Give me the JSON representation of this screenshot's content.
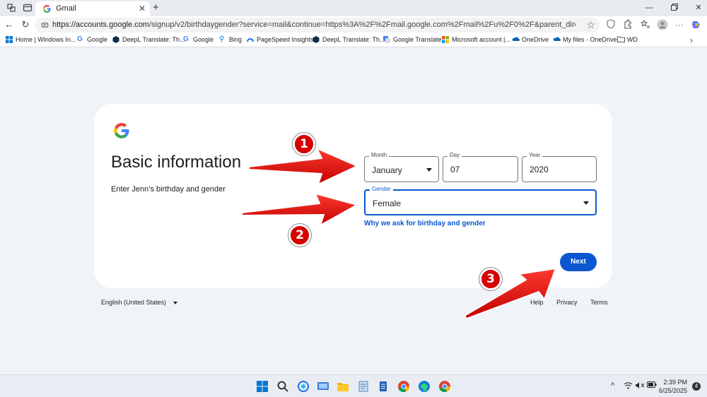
{
  "browser": {
    "tab_title": "Gmail",
    "url_host": "https://accounts.google.com",
    "url_path": "/signup/v2/birthdaygender?service=mail&continue=https%3A%2F%2Fmail.google.com%2Fmail%2Fu%2F0%2F&parent_directed=true&flowName=GlifWeb..."
  },
  "bookmarks": [
    {
      "label": "Home | Windows In...",
      "icon": "windows-icon"
    },
    {
      "label": "Google",
      "icon": "google-icon"
    },
    {
      "label": "DeepL Translate: Th...",
      "icon": "deepl-icon"
    },
    {
      "label": "Google",
      "icon": "google-icon"
    },
    {
      "label": "Bing",
      "icon": "bing-icon"
    },
    {
      "label": "PageSpeed Insights",
      "icon": "pagespeed-icon"
    },
    {
      "label": "DeepL Translate: Th...",
      "icon": "deepl-icon"
    },
    {
      "label": "Google Translate",
      "icon": "translate-icon"
    },
    {
      "label": "Microsoft account |...",
      "icon": "microsoft-icon"
    },
    {
      "label": "OneDrive",
      "icon": "onedrive-icon"
    },
    {
      "label": "My files - OneDrive",
      "icon": "onedrive-icon"
    },
    {
      "label": "WD",
      "icon": "folder-icon"
    }
  ],
  "form": {
    "heading": "Basic information",
    "subtext": "Enter Jenn’s birthday and gender",
    "month_label": "Month",
    "month_value": "January",
    "day_label": "Day",
    "day_value": "07",
    "year_label": "Year",
    "year_value": "2020",
    "gender_label": "Gender",
    "gender_value": "Female",
    "why_link": "Why we ask for birthday and gender",
    "next_label": "Next"
  },
  "footer": {
    "language": "English (United States)",
    "help": "Help",
    "privacy": "Privacy",
    "terms": "Terms"
  },
  "annotations": [
    "1",
    "2",
    "3"
  ],
  "taskbar": {
    "time": "2:39 PM",
    "date": "6/25/2025",
    "notifications": "4"
  },
  "colors": {
    "accent": "#0b57d0",
    "annotation_red": "#e00000",
    "page_bg": "#f0f4f9"
  }
}
